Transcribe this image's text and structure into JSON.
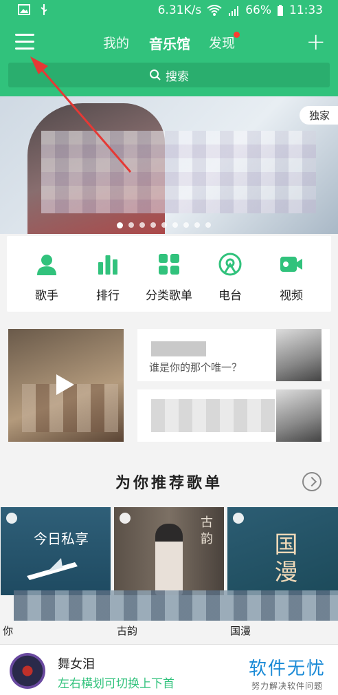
{
  "status_bar": {
    "speed": "6.31K/s",
    "battery": "66%",
    "time": "11:33"
  },
  "nav": {
    "tabs": [
      {
        "label": "我的"
      },
      {
        "label": "音乐馆"
      },
      {
        "label": "发现"
      }
    ],
    "active_tab": "音乐馆"
  },
  "search": {
    "label": "搜索"
  },
  "banner": {
    "badge": "独家",
    "page_count": 9,
    "active_index": 0
  },
  "quick_entries": [
    {
      "label": "歌手",
      "icon": "singer-icon"
    },
    {
      "label": "排行",
      "icon": "chart-icon"
    },
    {
      "label": "分类歌单",
      "icon": "grid-icon"
    },
    {
      "label": "电台",
      "icon": "radio-icon"
    },
    {
      "label": "视频",
      "icon": "video-icon"
    }
  ],
  "promo": {
    "card1_text": "谁是你的那个唯一？"
  },
  "section": {
    "title": "为你推荐歌单"
  },
  "playlists": [
    {
      "cover_text": "今日私享",
      "name": "你"
    },
    {
      "cover_text": "古韵",
      "name": "古韵"
    },
    {
      "cover_text": "国漫",
      "name": "国漫"
    }
  ],
  "player": {
    "song": "舞女泪",
    "hint": "左右横划可切换上下首"
  },
  "watermark": {
    "main": "软件无忧",
    "sub": "努力解决软件问题"
  },
  "colors": {
    "brand_green": "#31c27c",
    "annotation_red": "#e53935"
  }
}
